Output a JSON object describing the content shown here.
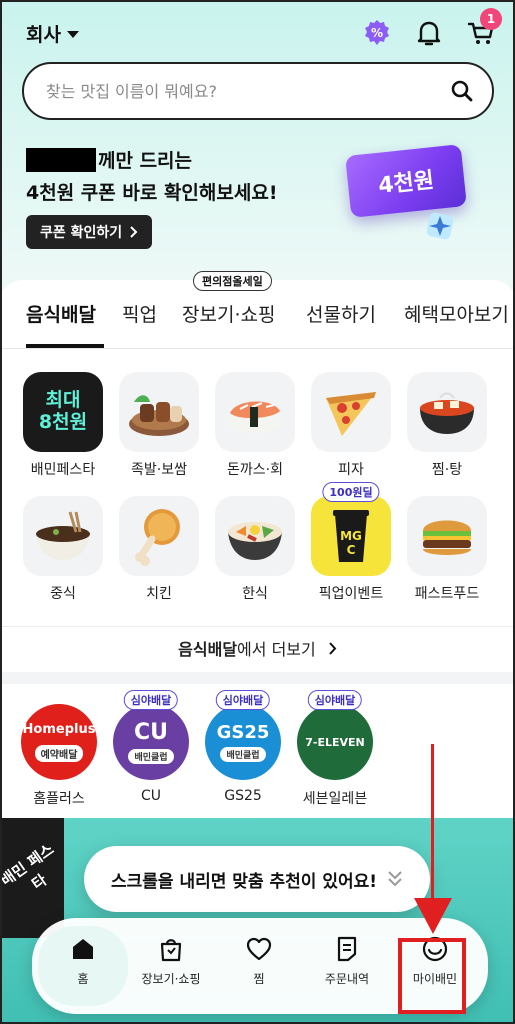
{
  "header": {
    "location": "회사",
    "cart_badge": "1"
  },
  "search": {
    "placeholder": "찾는 맛집 이름이 뭐예요?"
  },
  "banner": {
    "line1_suffix": "께만 드리는",
    "line2": "4천원 쿠폰 바로 확인해보세요!",
    "button_label": "쿠폰 확인하기",
    "ticket_text": "4천원"
  },
  "tabs": {
    "sale_chip": "편의점올세일",
    "items": [
      "음식배달",
      "픽업",
      "장보기·쇼핑",
      "선물하기",
      "혜택모아보기"
    ]
  },
  "categories": [
    {
      "label": "배민페스타",
      "tile_text": "최대\n8천원",
      "icon": "festa-badge-icon"
    },
    {
      "label": "족발·보쌈",
      "icon": "jokbal-icon"
    },
    {
      "label": "돈까스·회",
      "icon": "sushi-icon"
    },
    {
      "label": "피자",
      "icon": "pizza-icon"
    },
    {
      "label": "찜·탕",
      "icon": "stew-icon"
    },
    {
      "label": "중식",
      "icon": "jajangmyeon-icon"
    },
    {
      "label": "치킨",
      "icon": "chicken-icon"
    },
    {
      "label": "한식",
      "icon": "bibimbap-icon"
    },
    {
      "label": "픽업이벤트",
      "tag": "100원딜",
      "tile_text": "MGC",
      "icon": "mgc-cup-icon"
    },
    {
      "label": "패스트푸드",
      "icon": "burger-icon"
    }
  ],
  "more": {
    "bold": "음식배달",
    "rest": "에서 더보기"
  },
  "stores": [
    {
      "label": "홈플러스",
      "logo": "Homeplus",
      "sub": "예약배달",
      "color": "#e0201b"
    },
    {
      "label": "CU",
      "logo": "CU",
      "sub": "배민클럽",
      "tag": "심야배달",
      "color": "#6a3fa4"
    },
    {
      "label": "GS25",
      "logo": "GS25",
      "sub": "배민클럽",
      "tag": "심야배달",
      "color": "#1a8fd6"
    },
    {
      "label": "세븐일레븐",
      "logo": "7-ELEVEN",
      "tag": "심야배달",
      "color": "#1f6b3a"
    }
  ],
  "promo": {
    "ribbon": "배민 페스타"
  },
  "toast": {
    "text": "스크롤을 내리면 맞춤 추천이 있어요!"
  },
  "nav": {
    "items": [
      "홈",
      "장보기·쇼핑",
      "찜",
      "주문내역",
      "마이배민"
    ]
  },
  "colors": {
    "accent": "#2ac1bc",
    "highlight": "#e02020",
    "badge": "#f0467a",
    "ticket": "#7b3df0"
  }
}
